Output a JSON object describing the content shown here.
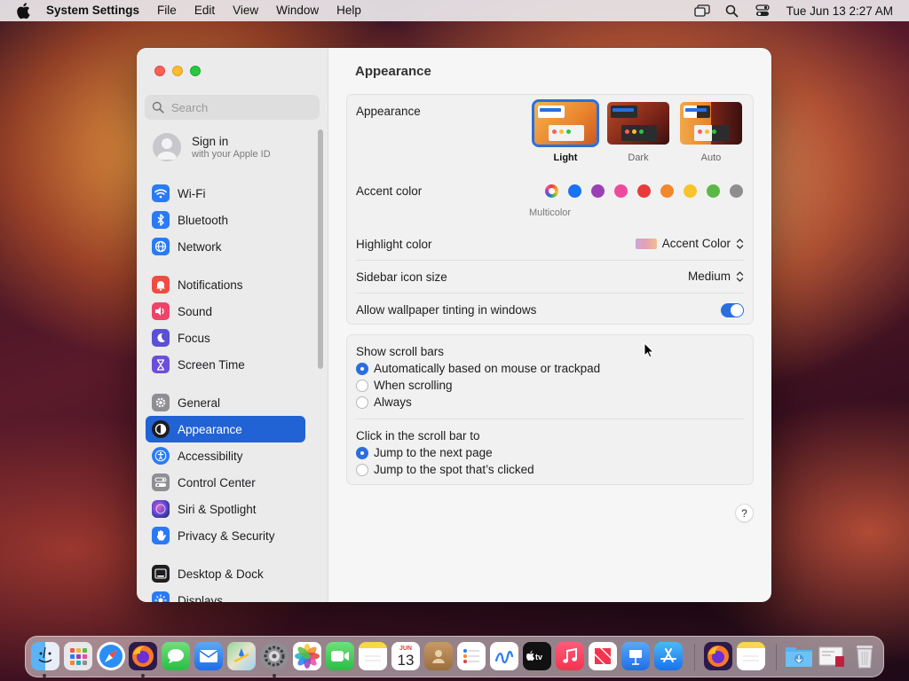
{
  "menubar": {
    "app_name": "System Settings",
    "menus": [
      "File",
      "Edit",
      "View",
      "Window",
      "Help"
    ],
    "clock": "Tue Jun 13  2:27 AM"
  },
  "sidebar": {
    "search_placeholder": "Search",
    "signin": {
      "title": "Sign in",
      "subtitle": "with your Apple ID"
    },
    "items": [
      {
        "label": "Wi-Fi",
        "icon": "wifi-icon",
        "color": "#2a7af5"
      },
      {
        "label": "Bluetooth",
        "icon": "bluetooth-icon",
        "color": "#2a7af5"
      },
      {
        "label": "Network",
        "icon": "globe-icon",
        "color": "#2a7af5"
      },
      {
        "label": "Notifications",
        "icon": "bell-icon",
        "color": "#f14b41"
      },
      {
        "label": "Sound",
        "icon": "speaker-icon",
        "color": "#f0436a"
      },
      {
        "label": "Focus",
        "icon": "moon-icon",
        "color": "#5b4fd6"
      },
      {
        "label": "Screen Time",
        "icon": "hourglass-icon",
        "color": "#6b4fd8"
      },
      {
        "label": "General",
        "icon": "gear-icon",
        "color": "#8e8e93"
      },
      {
        "label": "Appearance",
        "icon": "appearance-icon",
        "color": "#1d1d1f"
      },
      {
        "label": "Accessibility",
        "icon": "accessibility-icon",
        "color": "#2a7af5"
      },
      {
        "label": "Control Center",
        "icon": "toggles-icon",
        "color": "#8e8e93"
      },
      {
        "label": "Siri & Spotlight",
        "icon": "siri-icon",
        "color": "#3a3a6a"
      },
      {
        "label": "Privacy & Security",
        "icon": "hand-icon",
        "color": "#2a7af5"
      },
      {
        "label": "Desktop & Dock",
        "icon": "dock-icon",
        "color": "#1d1d1f"
      },
      {
        "label": "Displays",
        "icon": "sun-icon",
        "color": "#2a7af5"
      }
    ],
    "selected": "Appearance"
  },
  "content": {
    "title": "Appearance",
    "appearance": {
      "label": "Appearance",
      "options": [
        "Light",
        "Dark",
        "Auto"
      ],
      "selected": "Light"
    },
    "accent": {
      "label": "Accent color",
      "multicolor_label": "Multicolor",
      "colors": [
        "multicolor",
        "#1a73f0",
        "#9b3fb5",
        "#ee4a9c",
        "#e63b3b",
        "#f3872c",
        "#f7c42b",
        "#5cb845",
        "#8e8e8e"
      ],
      "selected": "multicolor"
    },
    "highlight": {
      "label": "Highlight color",
      "value": "Accent Color"
    },
    "sidebar_icon_size": {
      "label": "Sidebar icon size",
      "value": "Medium"
    },
    "wallpaper_tinting": {
      "label": "Allow wallpaper tinting in windows",
      "enabled": true
    },
    "scroll_bars": {
      "label": "Show scroll bars",
      "options": [
        "Automatically based on mouse or trackpad",
        "When scrolling",
        "Always"
      ],
      "selected": "Automatically based on mouse or trackpad"
    },
    "click_scroll": {
      "label": "Click in the scroll bar to",
      "options": [
        "Jump to the next page",
        "Jump to the spot that’s clicked"
      ],
      "selected": "Jump to the next page"
    },
    "help": "?"
  },
  "dock": {
    "calendar_month": "JUN",
    "calendar_day": "13",
    "apps": [
      "Finder",
      "Launchpad",
      "Safari",
      "Firefox",
      "Messages",
      "Mail",
      "Maps",
      "System Settings",
      "Photos",
      "FaceTime",
      "Notes",
      "Calendar",
      "Contacts",
      "Reminders",
      "Freeform",
      "TV",
      "Music",
      "News",
      "Keynote",
      "App Store",
      "Firefox",
      "Notes",
      "Downloads",
      "Documents",
      "Trash"
    ]
  }
}
